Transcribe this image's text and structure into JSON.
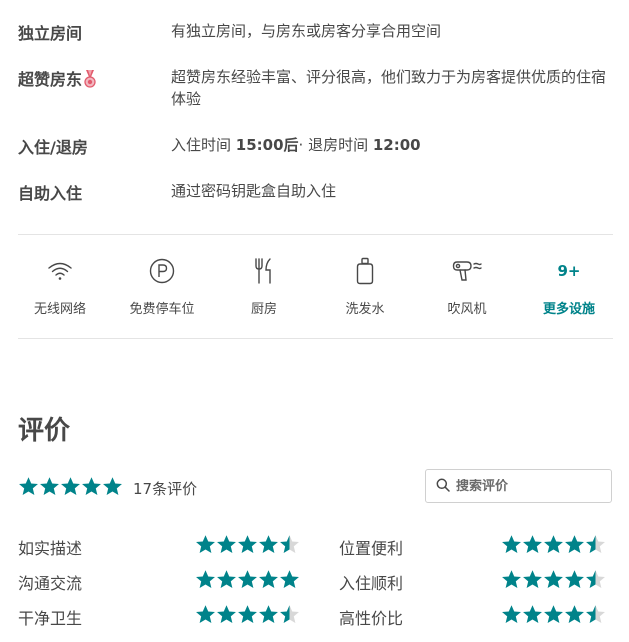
{
  "info": {
    "private_room": {
      "label": "独立房间",
      "value": "有独立房间，与房东或房客分享合用空间"
    },
    "superhost": {
      "label": "超赞房东",
      "badge_icon": "medal-icon",
      "value": "超赞房东经验丰富、评分很高，他们致力于为房客提供优质的住宿体验"
    },
    "checkin": {
      "label": "入住/退房",
      "checkin_prefix": "入住时间 ",
      "checkin_time": "15:00后",
      "separator": "· 退房时间 ",
      "checkout_time": "12:00"
    },
    "self_checkin": {
      "label": "自助入住",
      "value": "通过密码钥匙盒自助入住"
    }
  },
  "amenities": {
    "items": [
      {
        "icon": "wifi-icon",
        "label": "无线网络"
      },
      {
        "icon": "parking-icon",
        "label": "免费停车位"
      },
      {
        "icon": "kitchen-icon",
        "label": "厨房"
      },
      {
        "icon": "shampoo-icon",
        "label": "洗发水"
      },
      {
        "icon": "hair-dryer-icon",
        "label": "吹风机"
      }
    ],
    "more": {
      "count": "9+",
      "label": "更多设施"
    }
  },
  "reviews": {
    "title": "评价",
    "overall_rating": 5,
    "count_text": "17条评价",
    "search_placeholder": "搜索评价",
    "star_color": "#00838a",
    "categories": [
      {
        "label": "如实描述",
        "rating": 4.5
      },
      {
        "label": "位置便利",
        "rating": 4.5
      },
      {
        "label": "沟通交流",
        "rating": 5
      },
      {
        "label": "入住顺利",
        "rating": 4.5
      },
      {
        "label": "干净卫生",
        "rating": 4.5
      },
      {
        "label": "高性价比",
        "rating": 4.5
      }
    ]
  }
}
